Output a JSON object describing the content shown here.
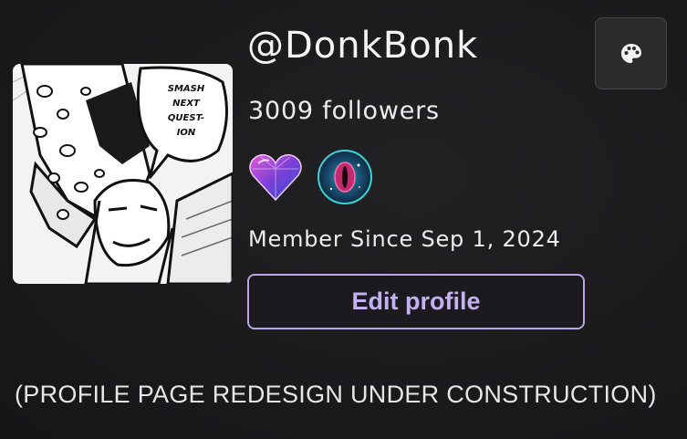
{
  "profile": {
    "username": "@DonkBonk",
    "followers_text": "3009 followers",
    "member_since": "Member Since Sep 1, 2024",
    "avatar_speech_lines": [
      "SMASH",
      "NEXT",
      "QUEST-",
      "ION"
    ]
  },
  "badges": [
    {
      "icon": "crystal-heart-icon",
      "color": "#8a3fd1"
    },
    {
      "icon": "cosmic-eye-icon",
      "color": "#1f6f8f"
    }
  ],
  "actions": {
    "edit_profile_label": "Edit profile",
    "theme_icon": "palette-icon"
  },
  "notice": "(PROFILE PAGE REDESIGN UNDER CONSTRUCTION)",
  "colors": {
    "background": "#1b1b1c",
    "accent": "#c3b2f2",
    "button_border": "#b9a5e8"
  }
}
